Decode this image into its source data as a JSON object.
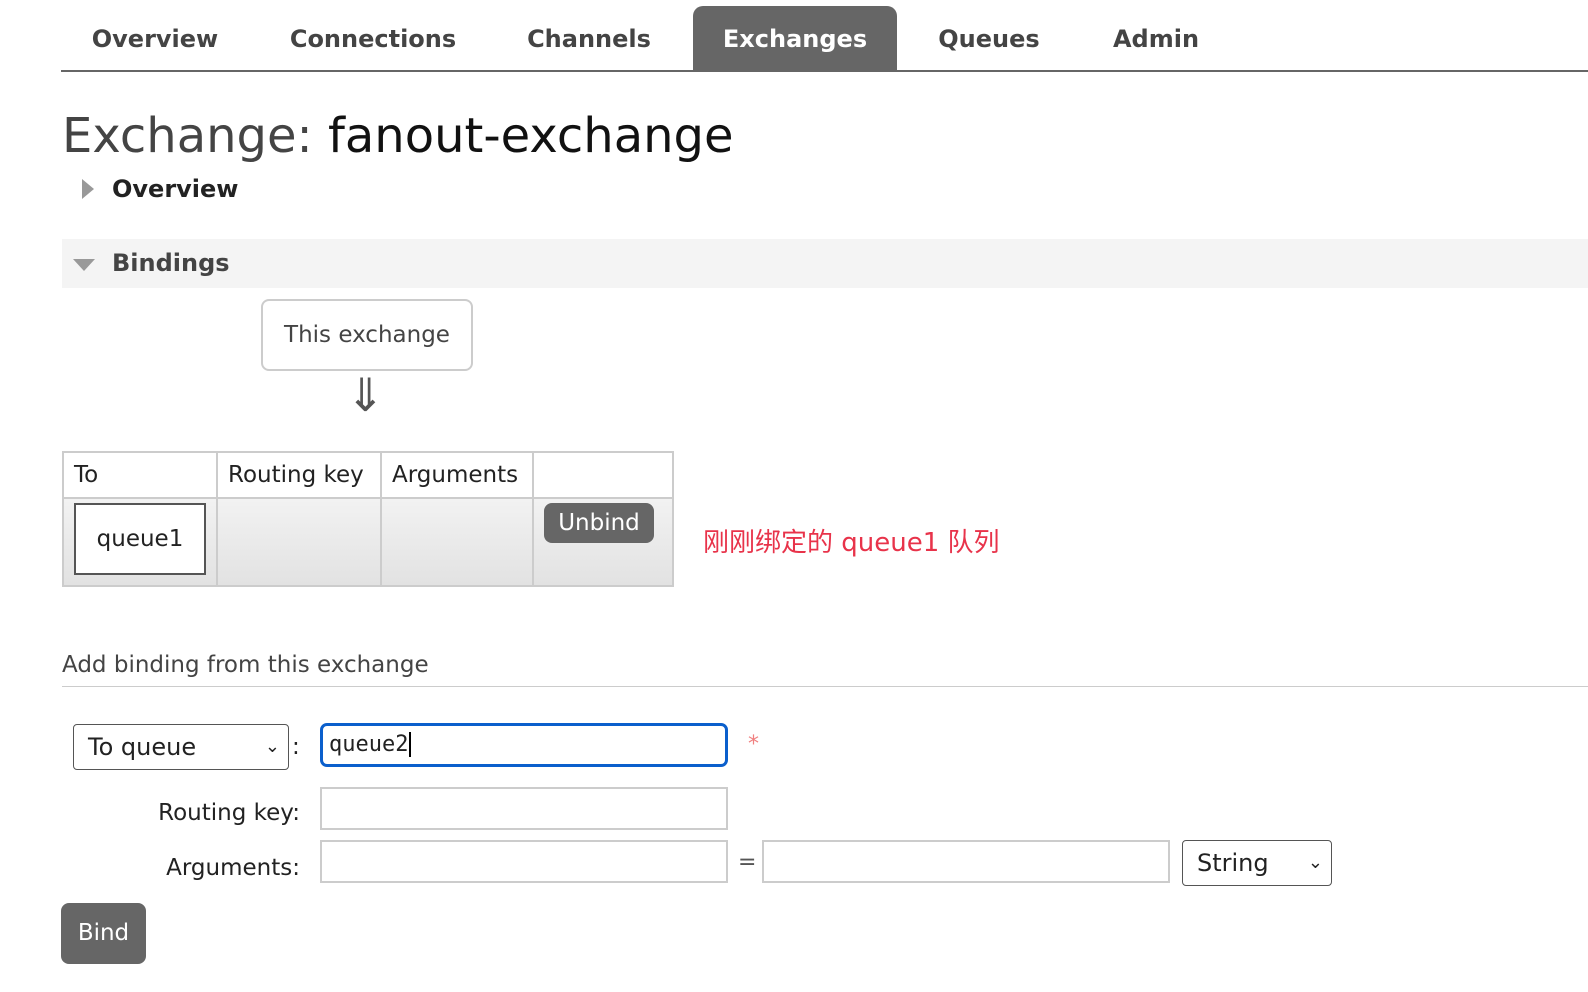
{
  "nav": {
    "tabs": [
      {
        "label": "Overview"
      },
      {
        "label": "Connections"
      },
      {
        "label": "Channels"
      },
      {
        "label": "Exchanges",
        "active": true
      },
      {
        "label": "Queues"
      },
      {
        "label": "Admin"
      }
    ]
  },
  "page": {
    "title_prefix": "Exchange:",
    "title_name": "fanout-exchange"
  },
  "sections": {
    "overview": "Overview",
    "bindings": "Bindings"
  },
  "bindings": {
    "source_label": "This exchange",
    "arrow": "⇓",
    "columns": [
      "To",
      "Routing key",
      "Arguments",
      ""
    ],
    "rows": [
      {
        "to": "queue1",
        "routing_key": "",
        "arguments": "",
        "action": "Unbind"
      }
    ]
  },
  "annotation": {
    "text": "刚刚绑定的 queue1 队列",
    "color": "#e8334a"
  },
  "add_binding": {
    "heading": "Add binding from this exchange",
    "destination_type": "To queue",
    "destination_value": "queue2",
    "required_mark": "*",
    "routing_key_label": "Routing key:",
    "routing_key_value": "",
    "arguments_label": "Arguments:",
    "argument_key": "",
    "equals": "=",
    "argument_value": "",
    "argument_type": "String",
    "colon": ":",
    "bind_label": "Bind"
  },
  "colors": {
    "accent": "#666666",
    "focus": "#0b5fcc"
  }
}
